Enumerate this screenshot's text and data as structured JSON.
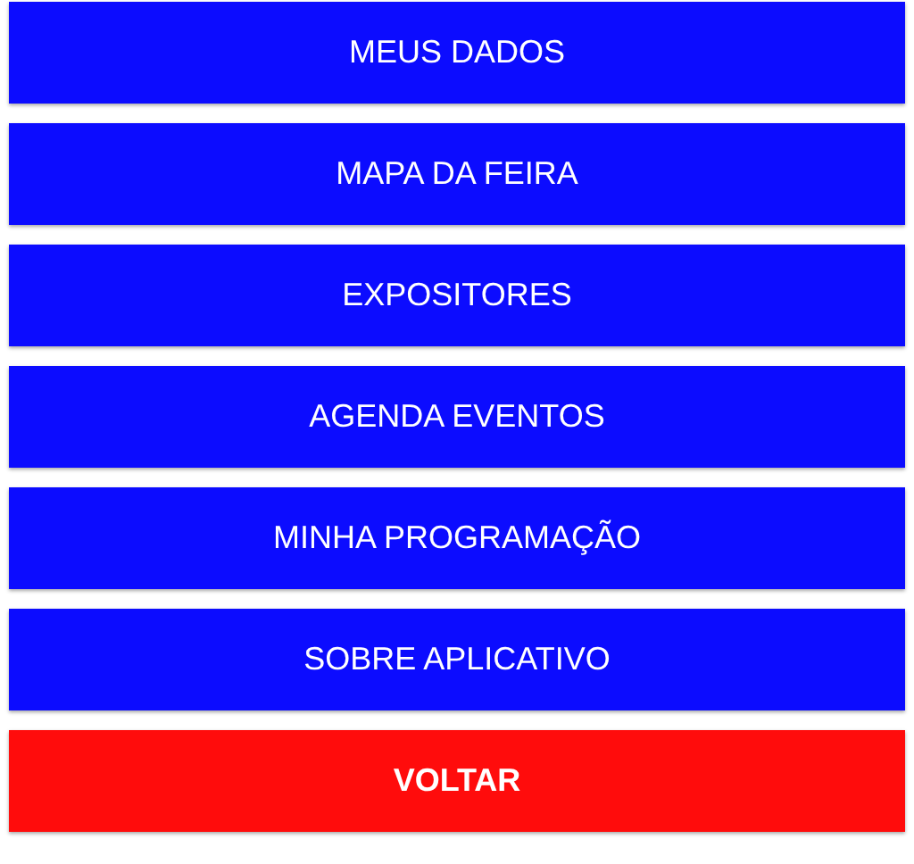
{
  "menu": [
    {
      "label": "MEUS DADOS",
      "kind": "menu"
    },
    {
      "label": "MAPA DA FEIRA",
      "kind": "menu"
    },
    {
      "label": "EXPOSITORES",
      "kind": "menu"
    },
    {
      "label": "AGENDA EVENTOS",
      "kind": "menu"
    },
    {
      "label": "MINHA PROGRAMAÇÃO",
      "kind": "menu"
    },
    {
      "label": "SOBRE APLICATIVO",
      "kind": "menu"
    },
    {
      "label": "VOLTAR",
      "kind": "back"
    }
  ]
}
